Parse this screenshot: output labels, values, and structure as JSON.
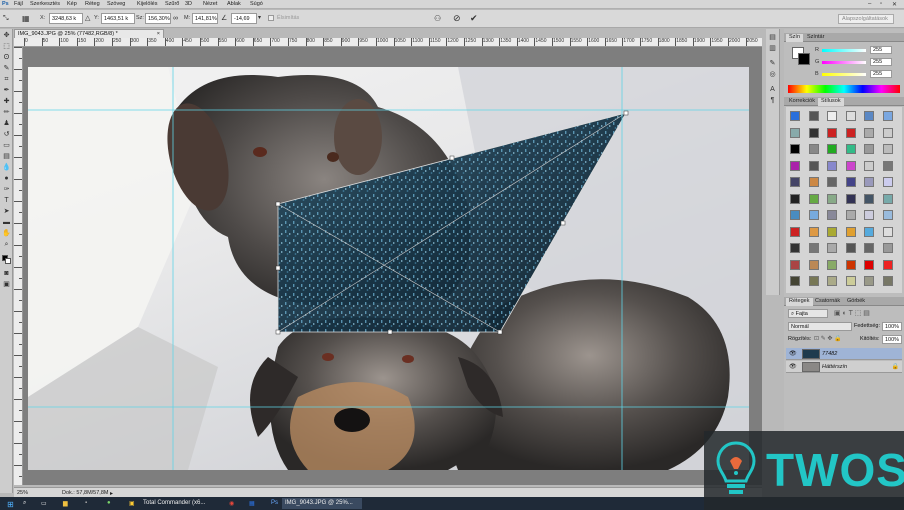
{
  "menubar": {
    "app_icon": "Ps",
    "items": [
      "Fájl",
      "Szerkesztés",
      "Kép",
      "Réteg",
      "Szöveg",
      "Kijelölés",
      "Szűrő",
      "3D",
      "Nézet",
      "Ablak",
      "Súgó"
    ]
  },
  "options": {
    "x_label": "X:",
    "x_value": "3248,63 k",
    "y_label": "Y:",
    "y_value": "1463,51 k",
    "w_label": "Sz:",
    "w_value": "156,30%",
    "h_label": "M:",
    "h_value": "141,81%",
    "angle_value": "-14,69",
    "antialias_label": "Élsimítás",
    "workspace": "Alapszolgáltatások"
  },
  "document": {
    "tab_title": "IMG_9043.JPG @ 25% (77482,RGB/8) *"
  },
  "ruler": {
    "top_ticks": [
      "0",
      "50",
      "100",
      "150",
      "200",
      "250",
      "300",
      "350",
      "400",
      "450",
      "500",
      "550",
      "600",
      "650",
      "700",
      "750",
      "800",
      "850",
      "900",
      "950",
      "1000",
      "1050",
      "1100",
      "1150",
      "1200",
      "1250",
      "1300",
      "1350",
      "1400",
      "1450",
      "1500",
      "1550",
      "1600",
      "1650",
      "1700",
      "1750",
      "1800",
      "1850",
      "1900",
      "1950",
      "2000",
      "2050",
      "2100"
    ]
  },
  "status": {
    "zoom": "25%",
    "doc": "Dok.: 57,8M/57,8M"
  },
  "taskbar": {
    "items": [
      "Total Commander (x6...",
      "IMG_9043.JPG @ 25%..."
    ]
  },
  "color_panel": {
    "tabs": [
      "Szín",
      "Színtár"
    ],
    "channels": [
      {
        "label": "R",
        "value": "255"
      },
      {
        "label": "G",
        "value": "255"
      },
      {
        "label": "B",
        "value": "255"
      }
    ]
  },
  "styles_panel": {
    "tabs": [
      "Korrekciók",
      "Stílusok"
    ]
  },
  "layers_panel": {
    "tabs": [
      "Rétegek",
      "Csatornák",
      "Görbék"
    ],
    "filter_label": "Fajta",
    "blend_mode": "Normál",
    "opacity_label": "Fedettség:",
    "opacity_value": "100%",
    "lock_label": "Rögzítés:",
    "fill_label": "Kitöltés:",
    "fill_value": "100%",
    "layers": [
      {
        "name": "77482",
        "selected": true
      },
      {
        "name": "Háttérszín",
        "selected": false
      }
    ]
  },
  "watermark": {
    "text": "TWOS"
  }
}
